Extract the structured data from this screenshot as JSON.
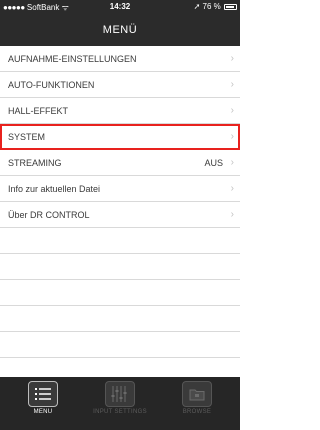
{
  "statusbar": {
    "signal": "●●●●●",
    "carrier": "SoftBank",
    "wifi": "ᯤ",
    "time": "14:32",
    "location": "➚",
    "battery": "76 %"
  },
  "header": {
    "title": "MENÜ"
  },
  "menu": {
    "items": [
      {
        "label": "AUFNAHME-EINSTELLUNGEN",
        "value": ""
      },
      {
        "label": "AUTO-FUNKTIONEN",
        "value": ""
      },
      {
        "label": "HALL-EFFEKT",
        "value": ""
      },
      {
        "label": "SYSTEM",
        "value": ""
      },
      {
        "label": "STREAMING",
        "value": "AUS"
      },
      {
        "label": "Info zur aktuellen Datei",
        "value": ""
      },
      {
        "label": "Über DR CONTROL",
        "value": ""
      }
    ],
    "chevron": "›",
    "selected_index": 3,
    "highlight_color": "#e8221e"
  },
  "tabbar": {
    "tabs": [
      {
        "label": "MENU",
        "icon": "list-icon",
        "active": true
      },
      {
        "label": "INPUT SETTINGS",
        "icon": "mixer-sliders-icon",
        "active": false
      },
      {
        "label": "BROWSE",
        "icon": "folder-icon",
        "active": false
      }
    ]
  }
}
